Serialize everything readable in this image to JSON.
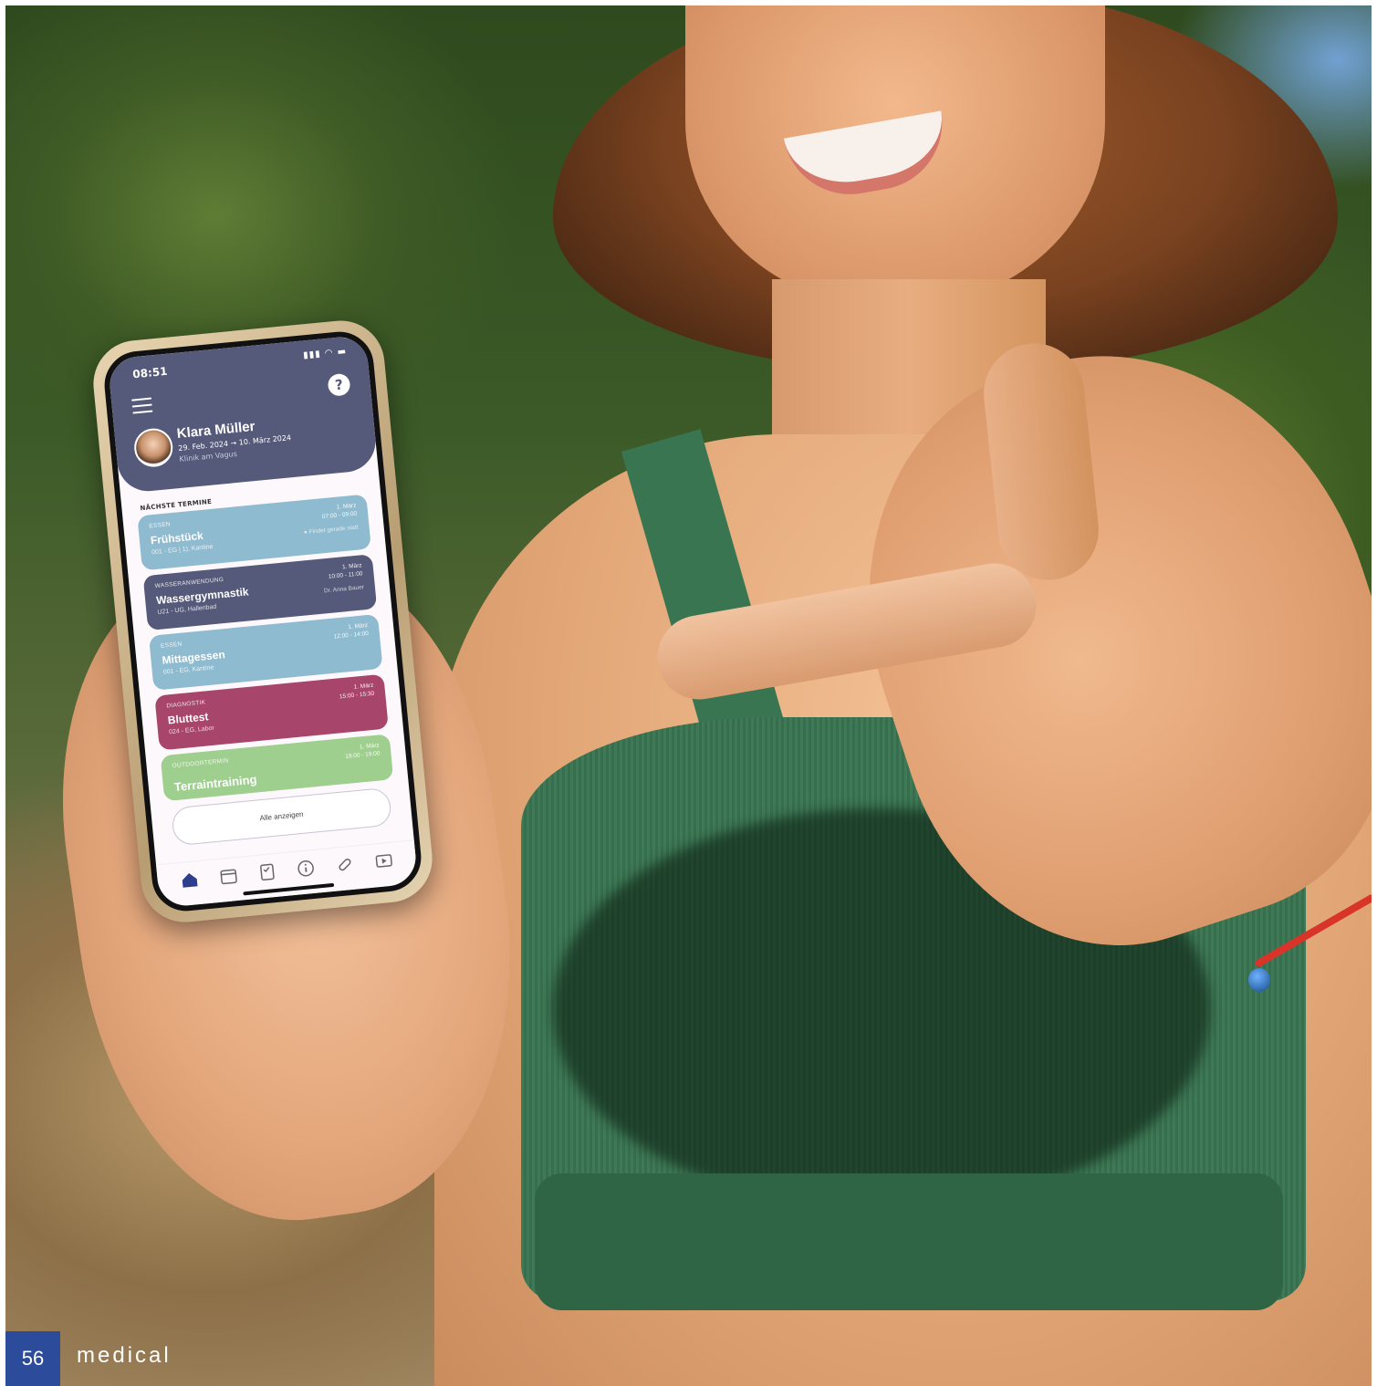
{
  "phone": {
    "status_time": "08:51",
    "user": {
      "name": "Klara Müller",
      "dates": "29. Feb. 2024 → 10. März 2024",
      "clinic": "Klinik am Vagus"
    },
    "section_title": "NÄCHSTE TERMINE",
    "appointments": [
      {
        "category": "ESSEN",
        "title": "Frühstück",
        "location": "001 - EG | 1), Kantine",
        "day": "1. März",
        "time": "07:00 - 09:00",
        "extra": "● Findet gerade statt"
      },
      {
        "category": "WASSERANWENDUNG",
        "title": "Wassergymnastik",
        "location": "U21 - UG, Hallenbad",
        "day": "1. März",
        "time": "10:00 - 11:00",
        "extra": "Dr. Anna Bauer"
      },
      {
        "category": "ESSEN",
        "title": "Mittagessen",
        "location": "001 - EG, Kantine",
        "day": "1. März",
        "time": "12:00 - 14:00",
        "extra": ""
      },
      {
        "category": "DIAGNOSTIK",
        "title": "Bluttest",
        "location": "024 - EG, Labor",
        "day": "1. März",
        "time": "15:00 - 15:30",
        "extra": ""
      },
      {
        "category": "OUTDOORTERMIN",
        "title": "Terraintraining",
        "location": "",
        "day": "1. März",
        "time": "18:00 - 19:00",
        "extra": ""
      }
    ],
    "all_button": "Alle anzeigen",
    "tabs": [
      "home-icon",
      "calendar-icon",
      "checklist-icon",
      "info-icon",
      "pill-icon",
      "play-icon"
    ],
    "colors": {
      "header": "#555a7a",
      "essen": "#8fbbd0",
      "diagnostik": "#a8456a",
      "outdoor": "#9fcf8e",
      "active_tab": "#2c3e8c"
    }
  },
  "footer": {
    "page_number": "56",
    "section": "medical"
  }
}
